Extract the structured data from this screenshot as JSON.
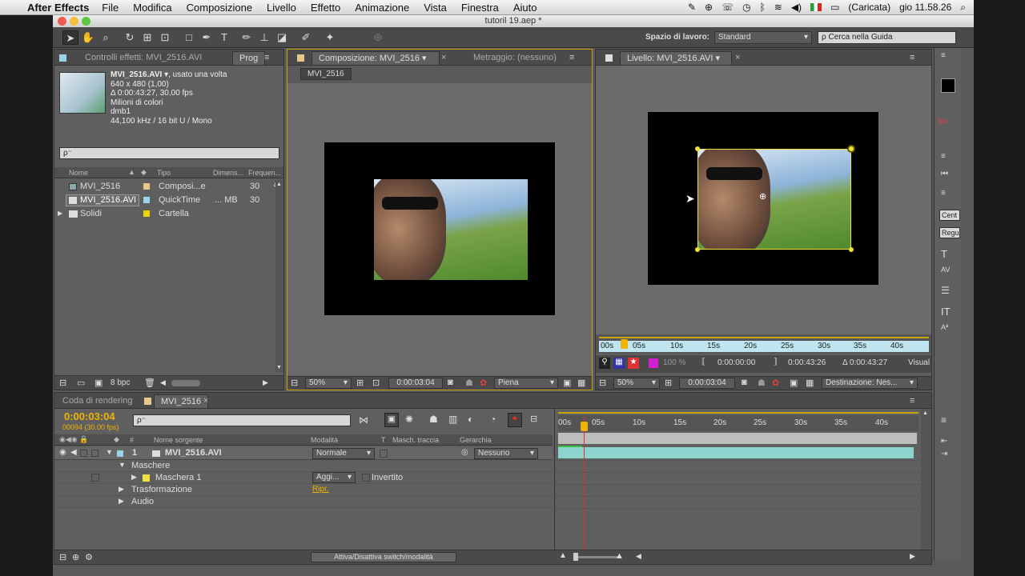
{
  "menubar": {
    "app": "After Effects",
    "menus": [
      "File",
      "Modifica",
      "Composizione",
      "Livello",
      "Effetto",
      "Animazione",
      "Vista",
      "Finestra",
      "Aiuto"
    ],
    "battery": "(Caricata)",
    "clock": "gio 11.58.26"
  },
  "window": {
    "title": "tutoril 19.aep *"
  },
  "toolbar": {
    "workspace_label": "Spazio di lavoro:",
    "workspace_value": "Standard",
    "help_placeholder": "Cerca nella Guida"
  },
  "project": {
    "tab_effects": "Controlli effetti: MVI_2516.AVI",
    "tab_project": "Prog",
    "file_name": "MVI_2516.AVI",
    "file_used": ", usato una volta",
    "info": [
      "640 x 480 (1,00)",
      "Δ 0:00:43:27, 30,00 fps",
      "Milioni di colori",
      "dmb1",
      "44,100 kHz / 16 bit U / Mono"
    ],
    "search_placeholder": "ρ⁻",
    "columns": [
      "Nome",
      "Tipo",
      "Dimens...",
      "Frequen..."
    ],
    "items": [
      {
        "name": "MVI_2516",
        "type": "Composi...e",
        "size": "",
        "fps": "30",
        "color": "#e8c88a"
      },
      {
        "name": "MVI_2516.AVI",
        "type": "QuickTime",
        "size": "... MB",
        "fps": "30",
        "color": "#9ad3e6"
      },
      {
        "name": "Solidi",
        "type": "Cartella",
        "size": "",
        "fps": "",
        "color": "#f0d400"
      }
    ],
    "bpc": "8 bpc"
  },
  "comp": {
    "tab": "Composizione: MVI_2516",
    "tab2": "Metraggio: (nessuno)",
    "label": "MVI_2516",
    "zoom": "50%",
    "time": "0:00:03:04",
    "quality": "Piena"
  },
  "layer": {
    "tab": "Livello: MVI_2516.AVI",
    "ruler": [
      "00s",
      "05s",
      "10s",
      "15s",
      "20s",
      "25s",
      "30s",
      "35s",
      "40s"
    ],
    "opacity": "100 %",
    "t_in": "0:00:00:00",
    "t_out": "0:00:43:26",
    "duration": "Δ 0:00:43:27",
    "visual": "Visual",
    "zoom": "50%",
    "time": "0:00:03:04",
    "dest": "Destinazione: Nes..."
  },
  "timeline": {
    "tab_render": "Coda di rendering",
    "tab_comp": "MVI_2516",
    "time": "0:00:03:04",
    "frames": "00094 (30.00 fps)",
    "search_placeholder": "ρ⁻",
    "columns": {
      "source": "Nome sorgente",
      "mode": "Modalità",
      "t": "T",
      "track": "Masch. traccia",
      "parent": "Gerarchia"
    },
    "layer_num": "1",
    "layer_name": "MVI_2516.AVI",
    "mode": "Normale",
    "parent": "Nessuno",
    "masks": "Maschere",
    "mask1": "Maschera 1",
    "mask_mode": "Aggi...",
    "inverted": "Invertito",
    "transform": "Trasformazione",
    "reset": "Ripr.",
    "audio": "Audio",
    "ruler": [
      "00s",
      "05s",
      "10s",
      "15s",
      "20s",
      "25s",
      "30s",
      "35s",
      "40s"
    ],
    "toggle": "Attiva/Disattiva switch/modalità"
  },
  "rightpanel": {
    "fps_label": "fps:",
    "center": "Cent",
    "regular": "Regu"
  },
  "colors": {
    "accent": "#f0b400",
    "track": "#8fd3cf",
    "mask_yellow": "#f0e040",
    "playhead": "#e03030"
  }
}
